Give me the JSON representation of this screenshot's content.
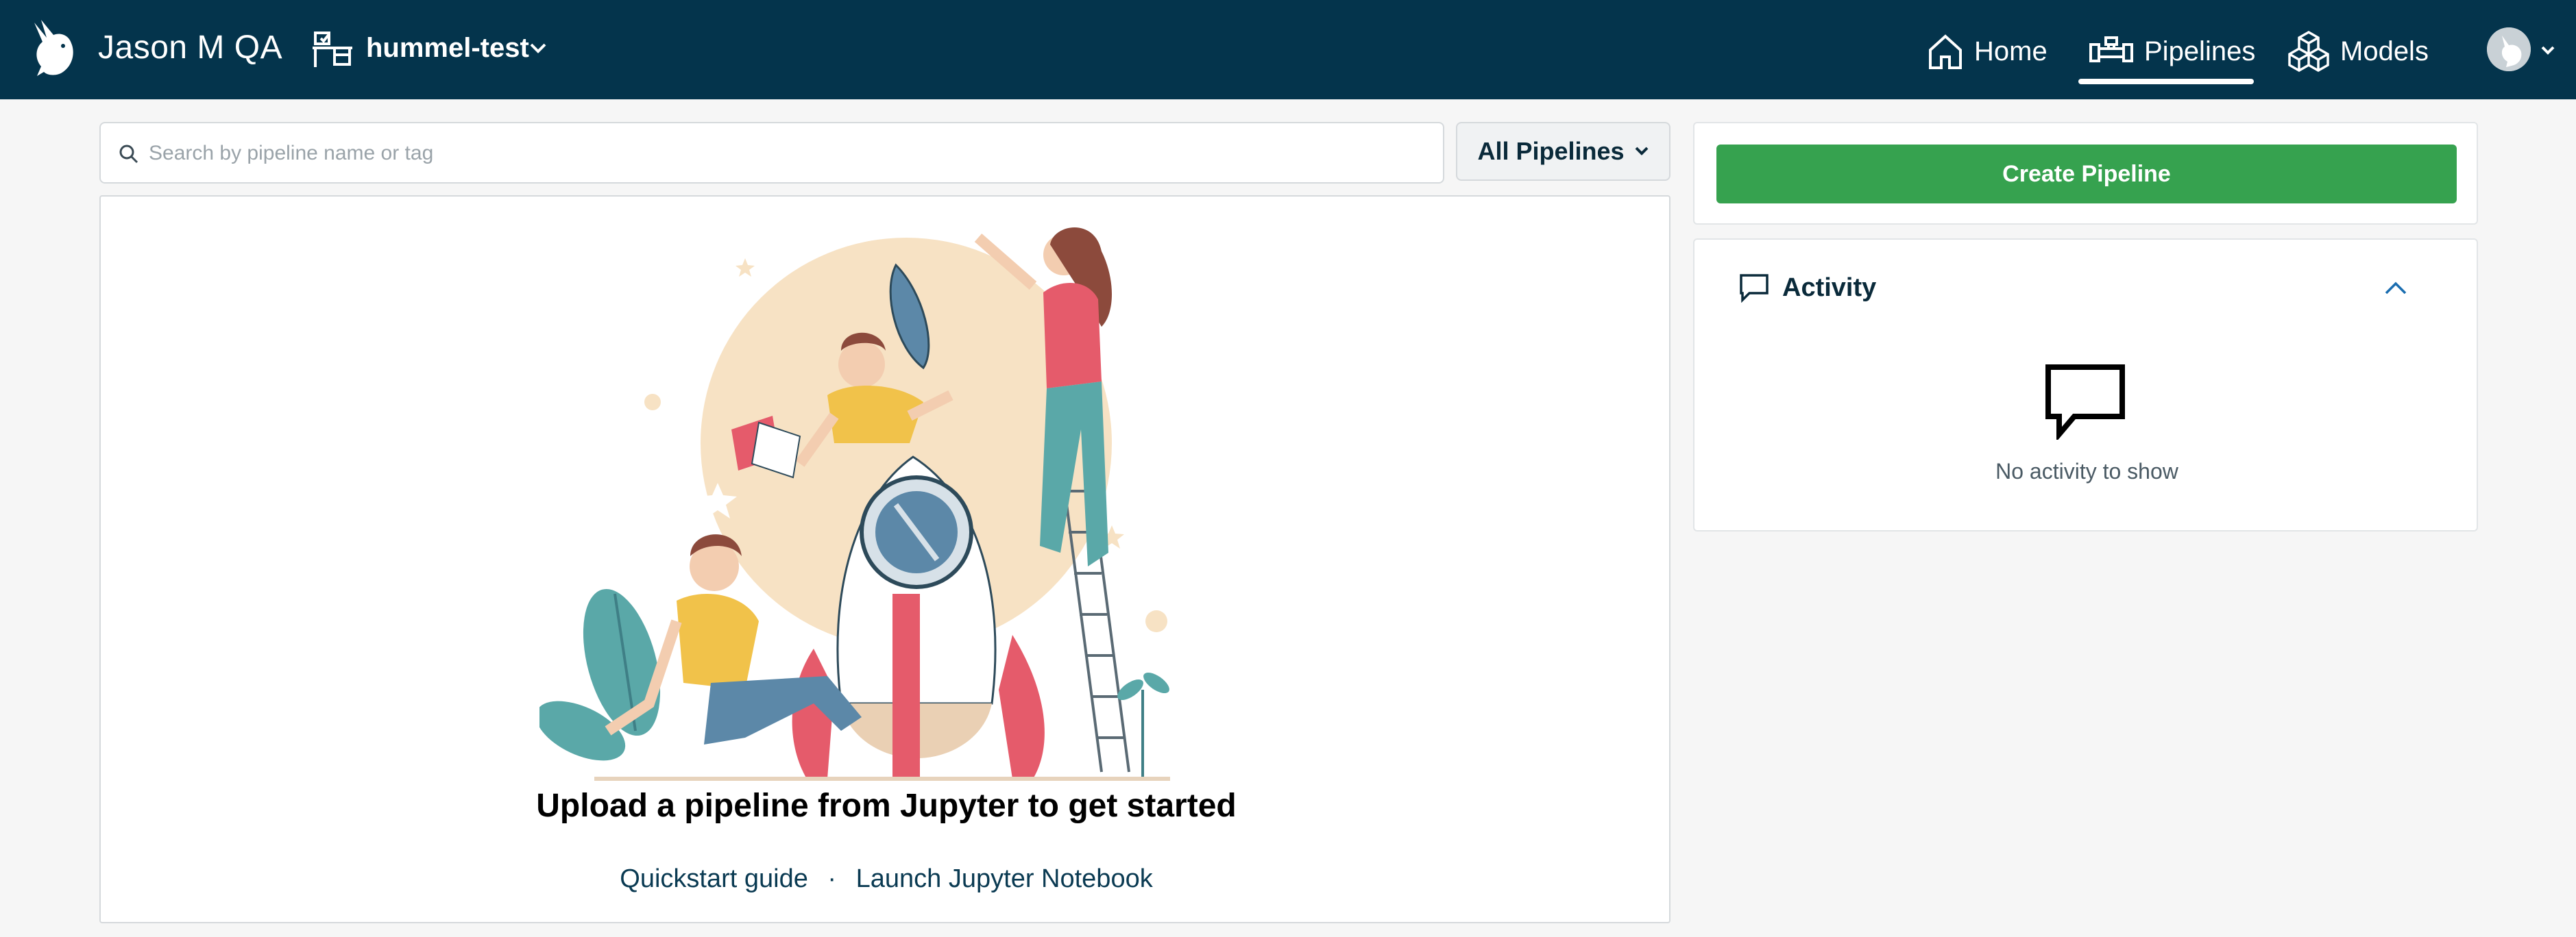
{
  "header": {
    "org_name": "Jason M QA",
    "workspace": "hummel-test",
    "nav": {
      "home": "Home",
      "pipelines": "Pipelines",
      "models": "Models",
      "active": "pipelines"
    },
    "icons": {
      "logo": "bird-logo-icon",
      "workspace": "desk-icon",
      "home": "home-icon",
      "pipelines": "pipe-icon",
      "models": "cubes-icon",
      "avatar": "bird-avatar-icon"
    }
  },
  "search": {
    "placeholder": "Search by pipeline name or tag",
    "value": ""
  },
  "filter": {
    "label": "All Pipelines"
  },
  "empty_state": {
    "title": "Upload a pipeline from Jupyter to get started",
    "link_quickstart": "Quickstart guide",
    "separator": "·",
    "link_jupyter": "Launch Jupyter Notebook",
    "illustration": "rocket-team-illustration"
  },
  "sidebar": {
    "create_label": "Create Pipeline",
    "activity_title": "Activity",
    "activity_empty": "No activity to show"
  },
  "colors": {
    "header_bg": "#04344c",
    "primary_green": "#36a24f",
    "page_bg": "#f6f6f6"
  }
}
